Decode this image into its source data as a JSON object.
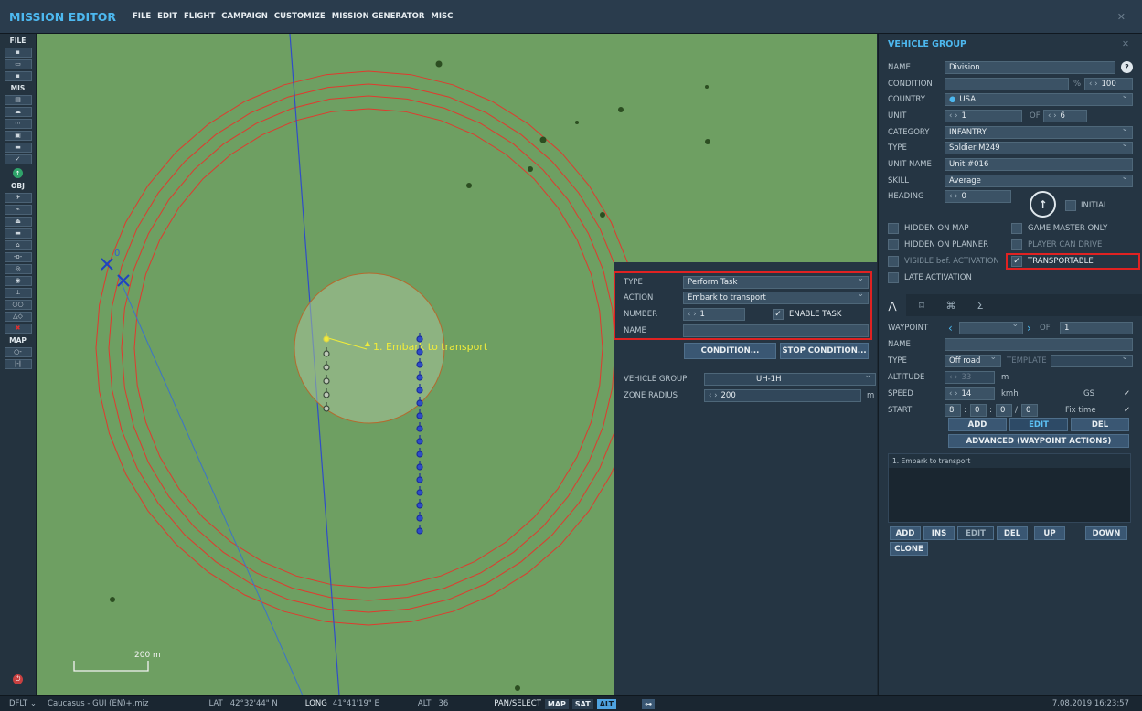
{
  "app": {
    "title": "MISSION EDITOR",
    "menu": [
      "FILE",
      "EDIT",
      "FLIGHT",
      "CAMPAIGN",
      "CUSTOMIZE",
      "MISSION GENERATOR",
      "MISC"
    ],
    "close_icon": "close-icon"
  },
  "toolbar": {
    "file_label": "FILE",
    "mis_label": "MIS",
    "obj_label": "OBJ",
    "map_label": "MAP"
  },
  "map": {
    "unit_group_label": "1. Embark to transport",
    "helo_label": "0",
    "scale_label": "200 m"
  },
  "task_panel": {
    "type_label": "TYPE",
    "type_value": "Perform Task",
    "action_label": "ACTION",
    "action_value": "Embark to transport",
    "number_label": "NUMBER",
    "number_value": "1",
    "enable_task_label": "ENABLE TASK",
    "name_label": "NAME",
    "name_value": "",
    "condition_button": "CONDITION...",
    "stop_condition_button": "STOP CONDITION...",
    "vehicle_group_label": "VEHICLE GROUP",
    "vehicle_group_value": "UH-1H",
    "zone_radius_label": "ZONE RADIUS",
    "zone_radius_value": "200",
    "zone_radius_unit": "m"
  },
  "vehicle_group": {
    "title": "VEHICLE GROUP",
    "name_label": "NAME",
    "name_value": "Division",
    "condition_label": "CONDITION",
    "condition_value": "",
    "condition_pct": "%",
    "condition_prob": "100",
    "country_label": "COUNTRY",
    "country_value": "USA",
    "unit_label": "UNIT",
    "unit_value": "1",
    "unit_of": "OF",
    "unit_total": "6",
    "category_label": "CATEGORY",
    "category_value": "INFANTRY",
    "type_label": "TYPE",
    "type_value": "Soldier M249",
    "unit_name_label": "UNIT NAME",
    "unit_name_value": "Unit #016",
    "skill_label": "SKILL",
    "skill_value": "Average",
    "heading_label": "HEADING",
    "heading_value": "0",
    "initial_label": "INITIAL",
    "hidden_on_map": "HIDDEN ON MAP",
    "game_master_only": "GAME MASTER ONLY",
    "hidden_on_planner": "HIDDEN ON PLANNER",
    "player_can_drive": "PLAYER CAN DRIVE",
    "visible_before_activation": "VISIBLE bef. ACTIVATION",
    "transportable": "TRANSPORTABLE",
    "late_activation": "LATE ACTIVATION"
  },
  "route": {
    "tabs": [
      "route-icon",
      "trigger-icon",
      "payload-icon",
      "summary-icon"
    ],
    "waypoint_label": "WAYPOINT",
    "waypoint_value": "",
    "waypoint_of": "OF",
    "waypoint_total": "1",
    "name_label": "NAME",
    "name_value": "",
    "type_label": "TYPE",
    "type_value": "Off road",
    "template_label": "TEMPLATE",
    "template_value": "",
    "altitude_label": "ALTITUDE",
    "altitude_value": "33",
    "altitude_unit": "m",
    "speed_label": "SPEED",
    "speed_value": "14",
    "speed_unit": "kmh",
    "gs_label": "GS",
    "start_label": "START",
    "start_d": "8",
    "start_h": "0",
    "start_m": "0",
    "start_s": "0",
    "fix_time_label": "Fix time",
    "add_button": "ADD",
    "edit_button": "EDIT",
    "del_button": "DEL",
    "advanced_button": "ADVANCED (WAYPOINT ACTIONS)",
    "actions_list": [
      "1. Embark to transport"
    ],
    "list_buttons": [
      "ADD",
      "INS",
      "EDIT",
      "DEL",
      "UP",
      "DOWN"
    ],
    "clone_button": "CLONE"
  },
  "statusbar": {
    "mode": "DFLT",
    "file": "Caucasus - GUI (EN)+.miz",
    "lat_label": "LAT",
    "lat_value": "42°32'44\" N",
    "long_label": "LONG",
    "long_value": "41°41'19\" E",
    "alt_label": "ALT",
    "alt_value": "36",
    "pan_select": "PAN/SELECT",
    "map_btn": "MAP",
    "sat_btn": "SAT",
    "alt_btn": "ALT",
    "datetime": "7.08.2019 16:23:57"
  },
  "colors": {
    "accent": "#4db8ef",
    "highlight": "#e02222",
    "map_green": "#6e9f62",
    "zone_line": "#e03a2e"
  }
}
